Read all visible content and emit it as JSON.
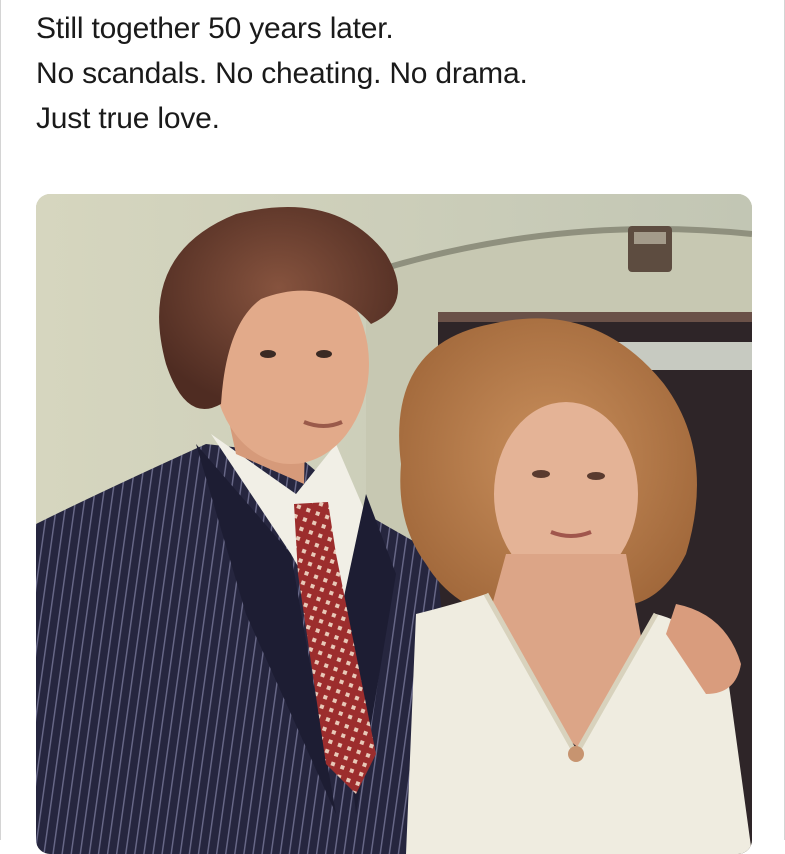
{
  "post": {
    "caption_lines": [
      "Still together 50 years later.",
      "No scandals. No cheating. No drama.",
      "Just true love."
    ]
  },
  "media": {
    "alt": "",
    "colors": {
      "wall": "#cfcfb6",
      "suit": "#26263f",
      "shirt": "#f1efe6",
      "tie": "#9c2d2d",
      "hair_man": "#6c4030",
      "hair_woman": "#b77a4a",
      "dress": "#efece0",
      "skin": "#e1ad8f"
    }
  }
}
